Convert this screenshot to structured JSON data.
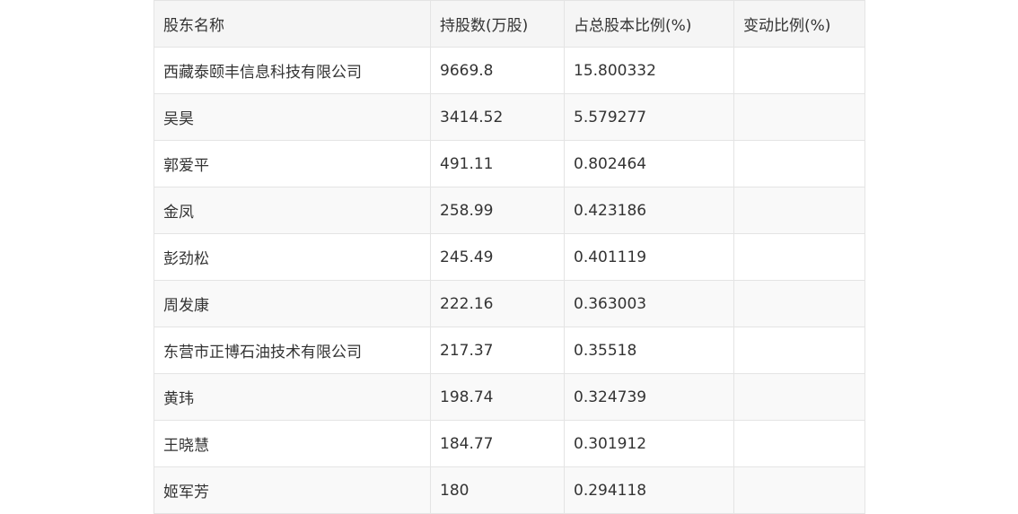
{
  "table": {
    "headers": [
      "股东名称",
      "持股数(万股)",
      "占总股本比例(%)",
      "变动比例(%)"
    ],
    "rows": [
      [
        "西藏泰颐丰信息科技有限公司",
        "9669.8",
        "15.800332",
        ""
      ],
      [
        "吴昊",
        "3414.52",
        "5.579277",
        ""
      ],
      [
        "郭爱平",
        "491.11",
        "0.802464",
        ""
      ],
      [
        "金凤",
        "258.99",
        "0.423186",
        ""
      ],
      [
        "彭劲松",
        "245.49",
        "0.401119",
        ""
      ],
      [
        "周发康",
        "222.16",
        "0.363003",
        ""
      ],
      [
        "东营市正博石油技术有限公司",
        "217.37",
        "0.35518",
        ""
      ],
      [
        "黄玮",
        "198.74",
        "0.324739",
        ""
      ],
      [
        "王晓慧",
        "184.77",
        "0.301912",
        ""
      ],
      [
        "姬军芳",
        "180",
        "0.294118",
        ""
      ]
    ]
  }
}
